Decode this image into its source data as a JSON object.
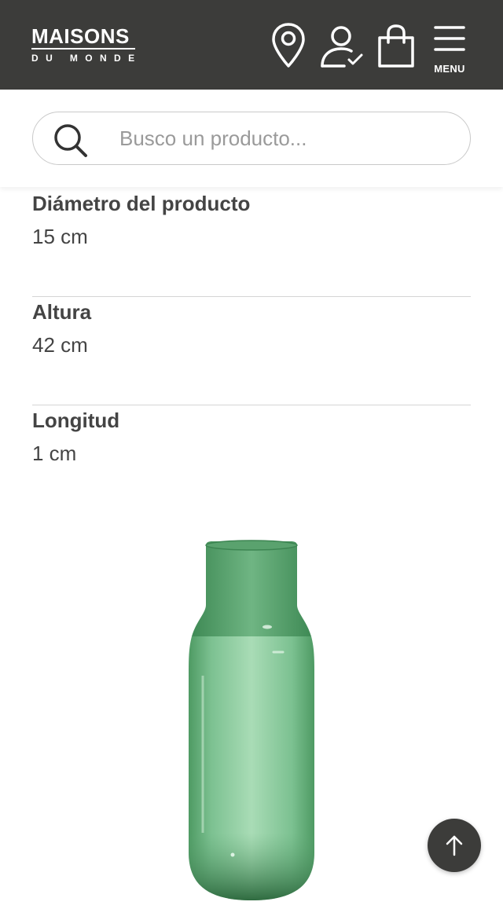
{
  "header": {
    "logo_main": "MAISONS",
    "logo_sub": "DU MONDE",
    "menu_label": "MENU",
    "icons": [
      "location-pin-icon",
      "account-icon",
      "shopping-bag-icon",
      "hamburger-menu-icon"
    ]
  },
  "search": {
    "placeholder": "Busco un producto...",
    "value": ""
  },
  "specs": [
    {
      "label": "Diámetro del producto",
      "value": "15 cm"
    },
    {
      "label": "Altura",
      "value": "42 cm"
    },
    {
      "label": "Longitud",
      "value": "1 cm"
    }
  ],
  "product": {
    "image": "green-glass-vase"
  },
  "colors": {
    "header_bg": "#3c3c3a",
    "vase_green": "#7cc191",
    "divider": "#d5d5d5"
  }
}
